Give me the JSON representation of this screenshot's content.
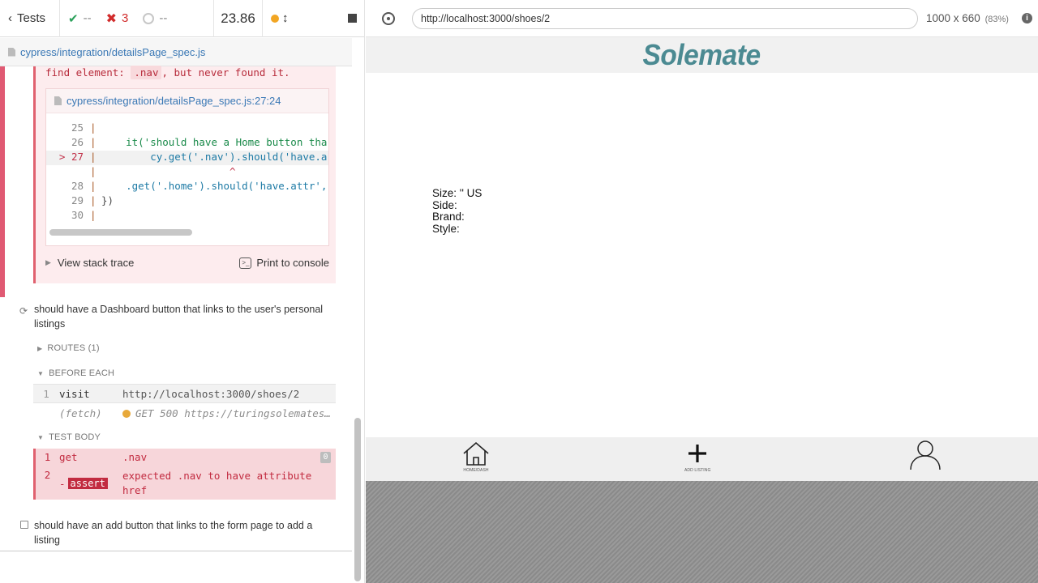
{
  "stats": {
    "back_label": "Tests",
    "passed": "--",
    "failed": "3",
    "pending": "--",
    "duration": "23.86"
  },
  "spec": {
    "path": "cypress/integration/detailsPage_spec.js"
  },
  "error": {
    "message_prefix": "find element:",
    "message_code": ".nav",
    "message_suffix": ", but never found it.",
    "frame_path": "cypress/integration/detailsPage_spec.js:27:24",
    "code_lines": [
      {
        "num": "25",
        "code": ""
      },
      {
        "num": "26",
        "code": "    it('should have a Home button tha"
      },
      {
        "num": "> 27",
        "code": "        cy.get('.nav').should('have.a"
      },
      {
        "num": "",
        "code": "                     ^"
      },
      {
        "num": "28",
        "code": "    .get('.home').should('have.attr',"
      },
      {
        "num": "29",
        "code": "})"
      },
      {
        "num": "30",
        "code": ""
      }
    ],
    "stack_trace_label": "View stack trace",
    "print_console_label": "Print to console"
  },
  "test2": {
    "title": "should have a Dashboard button that links to the user's personal listings",
    "routes_label": "ROUTES (1)",
    "before_each_label": "BEFORE EACH",
    "visit": {
      "num": "1",
      "name": "visit",
      "msg": "http://localhost:3000/shoes/2"
    },
    "fetch": {
      "name": "(fetch)",
      "msg": "GET 500 https://turingsolemates…"
    },
    "test_body_label": "TEST BODY",
    "get": {
      "num": "1",
      "name": "get",
      "msg": ".nav",
      "badge": "0"
    },
    "assert": {
      "num": "2",
      "prefix": "-",
      "name": "assert",
      "msg": "expected .nav to have attribute href"
    }
  },
  "test3": {
    "title": "should have an add button that links to the form page to add a listing"
  },
  "aut": {
    "url": "http://localhost:3000/shoes/2",
    "viewport": "1000 x 660",
    "scale": "(83%)"
  },
  "app": {
    "logo": "Solemate",
    "details": {
      "size": "Size: '' US",
      "side": "Side:",
      "brand": "Brand:",
      "style": "Style:"
    },
    "nav": [
      {
        "icon": "home-icon",
        "caption": "HOME/DASH"
      },
      {
        "icon": "plus-icon",
        "caption": "ADD LISTING"
      },
      {
        "icon": "user-icon",
        "caption": ""
      }
    ]
  }
}
